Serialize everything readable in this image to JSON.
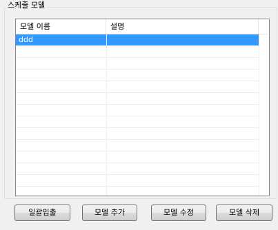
{
  "groupbox": {
    "title": "스케줄 모델"
  },
  "listview": {
    "columns": [
      "모델 이름",
      "설명"
    ],
    "rows": [
      {
        "name": "ddd",
        "description": "",
        "selected": true
      }
    ]
  },
  "buttons": {
    "daily": "일괄입출",
    "add": "모델 추가",
    "edit": "모델 수정",
    "delete": "모델 삭제"
  },
  "colors": {
    "selection": "#3399ff",
    "list_border": "#828790",
    "background": "#f0f0f0"
  }
}
